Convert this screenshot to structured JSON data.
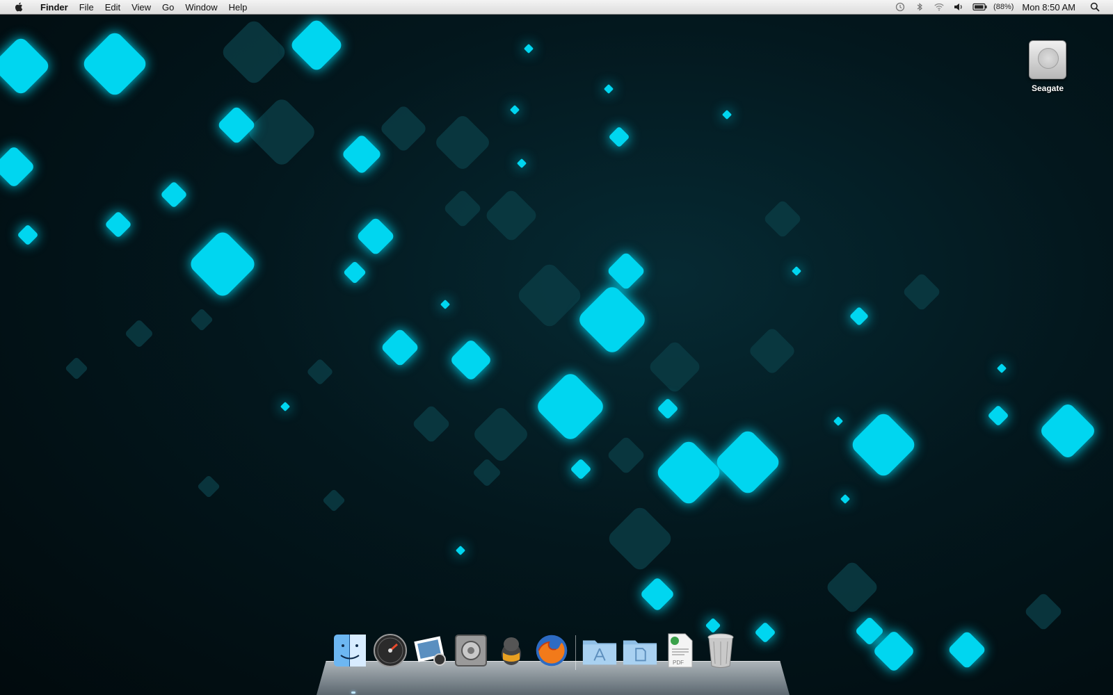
{
  "menubar": {
    "app": "Finder",
    "menus": [
      "File",
      "Edit",
      "View",
      "Go",
      "Window",
      "Help"
    ],
    "battery_percent": "(88%)",
    "clock": "Mon 8:50 AM",
    "icons": [
      "time-machine-icon",
      "bluetooth-icon",
      "wifi-icon",
      "volume-icon",
      "battery-icon",
      "spotlight-icon"
    ]
  },
  "desktop": {
    "drive_label": "Seagate",
    "accent_color": "#00d6f0"
  },
  "dock": {
    "apps": [
      "finder-icon",
      "dashboard-icon",
      "iphoto-icon",
      "system-preferences-icon",
      "adium-icon",
      "firefox-icon"
    ],
    "folders": [
      "applications-folder-icon",
      "documents-folder-icon",
      "pdf-document-icon",
      "trash-icon"
    ]
  }
}
